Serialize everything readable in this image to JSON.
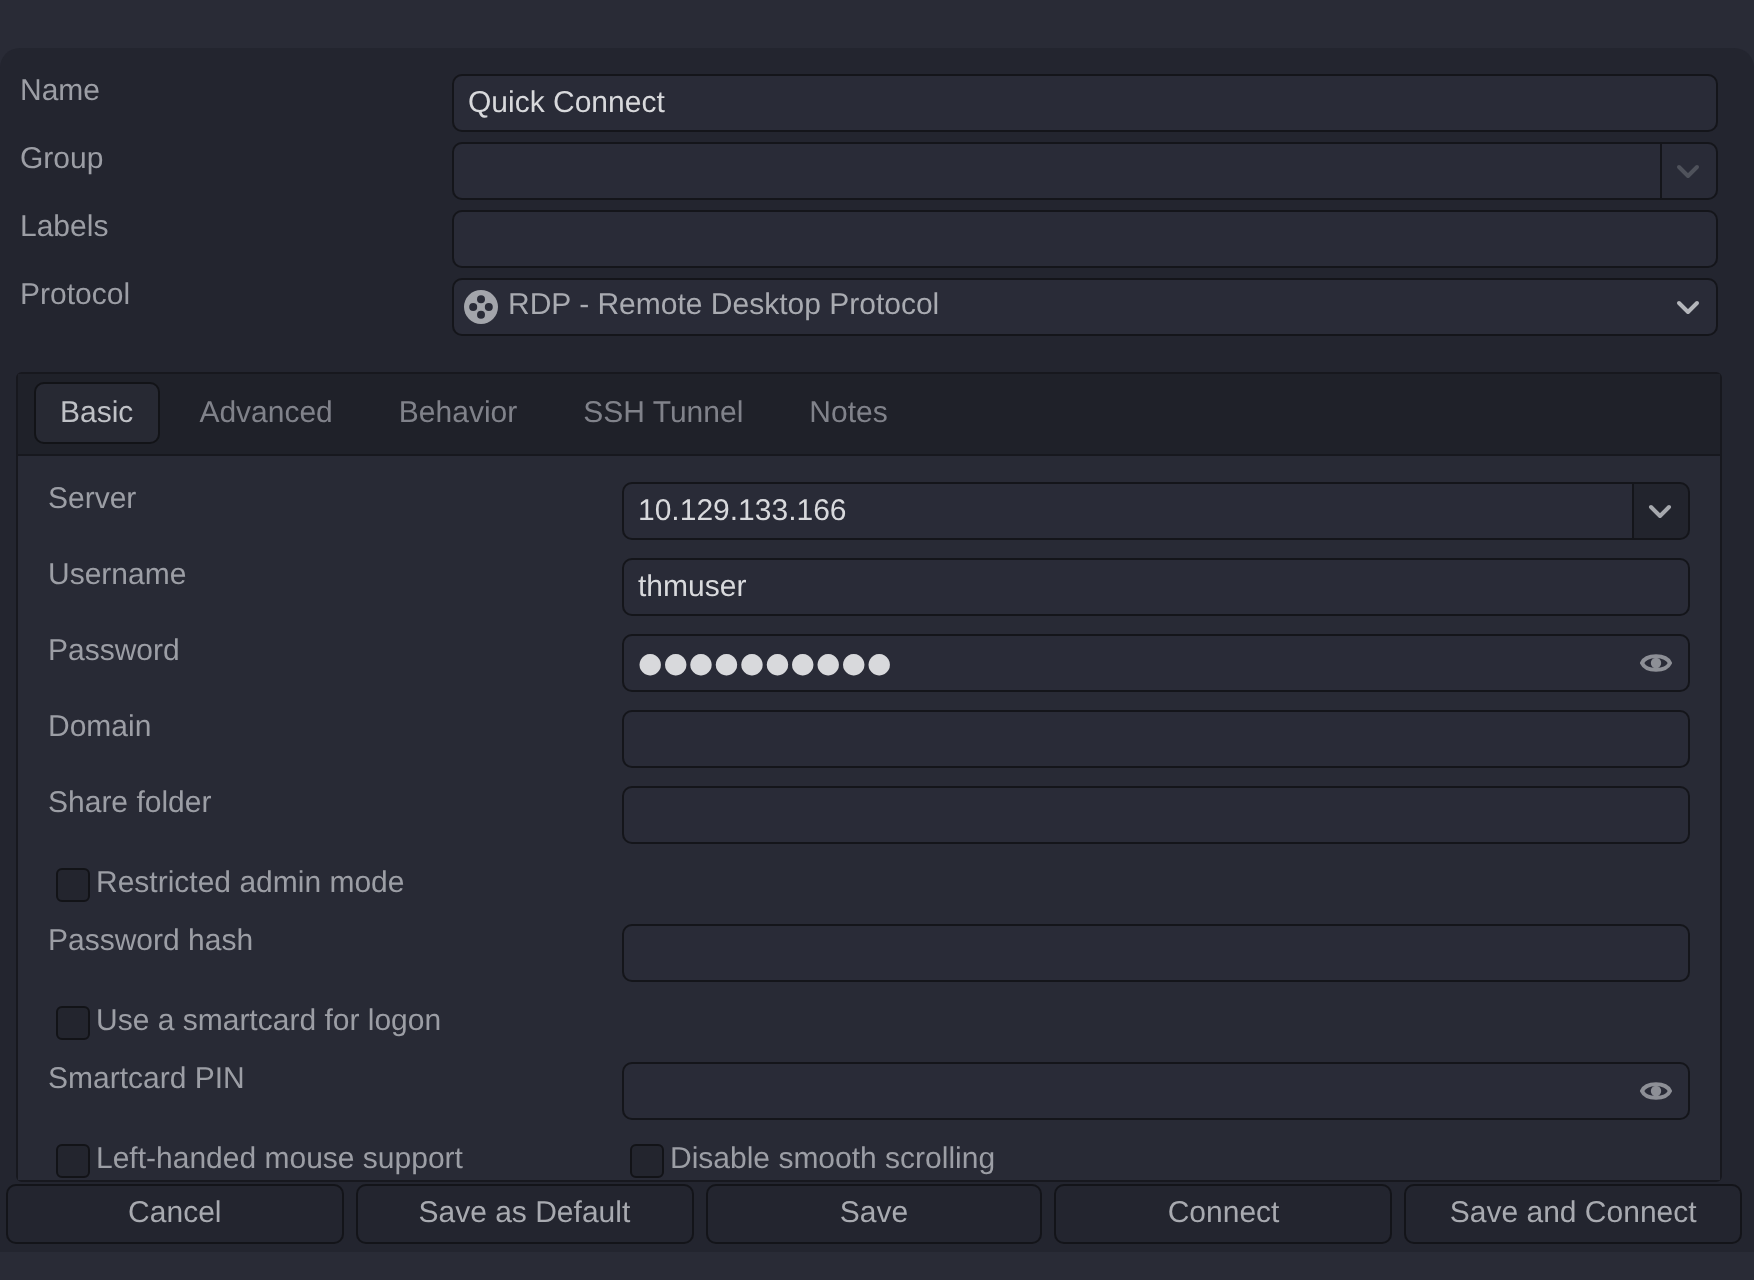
{
  "form": [
    {
      "kind": "entry",
      "label": "Name",
      "value": "Quick Connect"
    },
    {
      "kind": "combo",
      "label": "Group",
      "toggle_disabled": true
    },
    {
      "kind": "entry",
      "label": "Labels"
    },
    {
      "kind": "dropdown",
      "label": "Protocol",
      "value": "RDP - Remote Desktop Protocol"
    }
  ],
  "tabs": [
    {
      "label": "Basic",
      "selected": true
    },
    {
      "label": "Advanced",
      "selected": false
    },
    {
      "label": "Behavior",
      "selected": false
    },
    {
      "label": "SSH Tunnel",
      "selected": false
    },
    {
      "label": "Notes",
      "selected": false
    }
  ],
  "basic": [
    {
      "kind": "combo",
      "label": "Server",
      "value": "10.129.133.166",
      "toggle_disabled": false
    },
    {
      "kind": "entry",
      "label": "Username",
      "value": "thmuser"
    },
    {
      "kind": "password",
      "label": "Password",
      "value": "●●●●●●●●●●"
    },
    {
      "kind": "entry",
      "label": "Domain"
    },
    {
      "kind": "entry",
      "label": "Share folder"
    },
    {
      "kind": "checkbox",
      "label": "Restricted admin mode",
      "checked": false
    },
    {
      "kind": "entry",
      "label": "Password hash"
    },
    {
      "kind": "checkbox",
      "label": "Use a smartcard for logon",
      "checked": false
    },
    {
      "kind": "password",
      "label": "Smartcard PIN"
    },
    {
      "kind": "checkbox_pair",
      "items": [
        {
          "label": "Left-handed mouse support",
          "checked": false
        },
        {
          "label": "Disable smooth scrolling",
          "checked": false
        }
      ]
    }
  ],
  "buttons": [
    "Cancel",
    "Save as Default",
    "Save",
    "Connect",
    "Save and Connect"
  ]
}
